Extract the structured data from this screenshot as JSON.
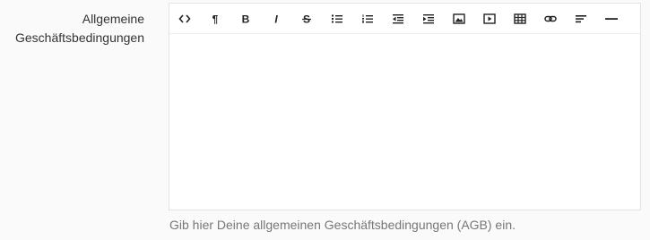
{
  "field": {
    "label_line1": "Allgemeine",
    "label_line2": "Geschäftsbedingungen",
    "help_text": "Gib hier Deine allgemeinen Geschäftsbedingungen (AGB) ein."
  },
  "editor": {
    "toolbar": [
      {
        "icon": "code-view-icon"
      },
      {
        "icon": "paragraph-icon",
        "glyph": "¶"
      },
      {
        "icon": "bold-icon",
        "glyph": "B"
      },
      {
        "icon": "italic-icon",
        "glyph": "I"
      },
      {
        "icon": "strikethrough-icon",
        "glyph": "S"
      },
      {
        "icon": "unordered-list-icon"
      },
      {
        "icon": "ordered-list-icon"
      },
      {
        "icon": "outdent-icon"
      },
      {
        "icon": "indent-icon"
      },
      {
        "icon": "image-icon"
      },
      {
        "icon": "video-icon"
      },
      {
        "icon": "table-icon"
      },
      {
        "icon": "link-icon"
      },
      {
        "icon": "align-icon"
      },
      {
        "icon": "horizontal-rule-icon"
      }
    ],
    "content": ""
  },
  "colors": {
    "page_background": "#fafafa",
    "editor_border": "#e3e3e3",
    "label_text": "#333333",
    "help_text": "#777777",
    "icon": "#222222"
  }
}
